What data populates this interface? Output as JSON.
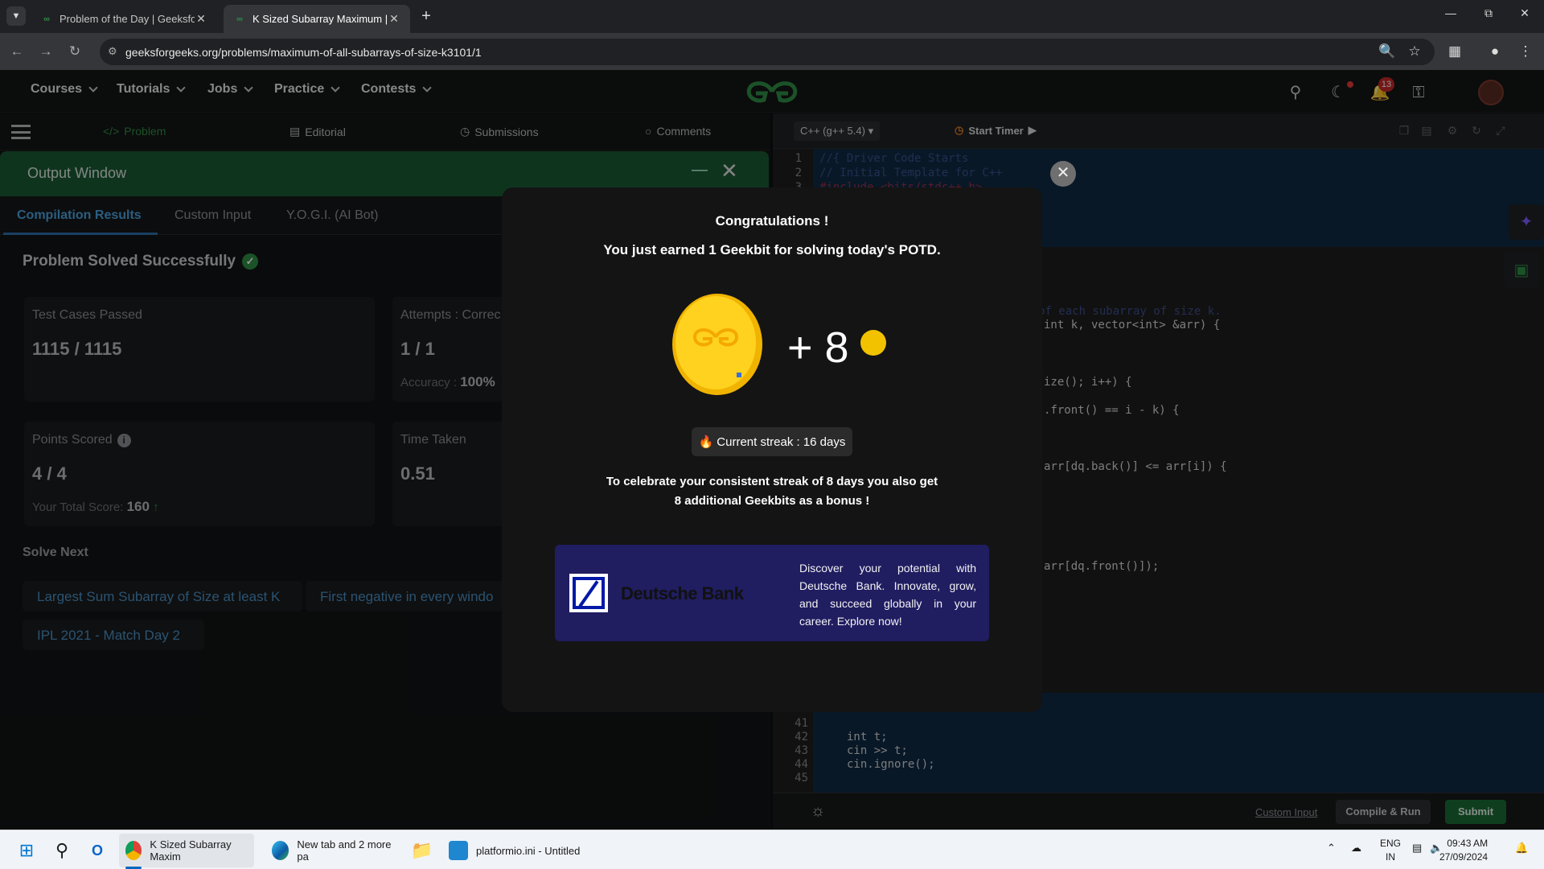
{
  "browser": {
    "tabs": [
      {
        "title": "Problem of the Day | GeeksforG",
        "favicon": "gfg-favicon"
      },
      {
        "title": "K Sized Subarray Maximum | Pr",
        "favicon": "gfg-favicon",
        "active": true
      }
    ],
    "url": "geeksforgeeks.org/problems/maximum-of-all-subarrays-of-size-k3101/1"
  },
  "site_nav": {
    "items": [
      "Courses",
      "Tutorials",
      "Jobs",
      "Practice",
      "Contests"
    ],
    "notification_count": "13",
    "brand_color": "#2f8d46"
  },
  "problem_tabs": [
    "Problem",
    "Editorial",
    "Submissions",
    "Comments"
  ],
  "output_window": {
    "title": "Output Window",
    "tabs": [
      "Compilation Results",
      "Custom Input",
      "Y.O.G.I. (AI Bot)"
    ],
    "status": "Problem Solved Successfully",
    "cards": {
      "test_cases": {
        "label": "Test Cases Passed",
        "value": "1115 / 1115"
      },
      "attempts": {
        "label": "Attempts : Correc",
        "value": "1 / 1",
        "accuracy_label": "Accuracy :",
        "accuracy_value": "100%"
      },
      "points": {
        "label": "Points Scored",
        "value": "4 / 4",
        "total_label": "Your Total Score:",
        "total_value": "160"
      },
      "time": {
        "label": "Time Taken",
        "value": "0.51"
      }
    },
    "solve_next_heading": "Solve Next",
    "solve_next": [
      "Largest Sum Subarray of Size at least K",
      "First negative in every windo",
      "IPL 2021 - Match Day 2"
    ]
  },
  "editor": {
    "language": "C++ (g++ 5.4)",
    "timer_label": "Start Timer",
    "lines_top": [
      {
        "n": "1",
        "text": "//{ Driver Code Starts"
      },
      {
        "n": "2",
        "text": "// Initial Template for C++"
      },
      {
        "n": "3",
        "text": "#include <bits/stdc++.h>"
      }
    ],
    "fragments": [
      "of each subarray of size k.",
      "int k, vector<int> &arr) {",
      "ize(); i++) {",
      ".front() == i - k) {",
      "arr[dq.back()] <= arr[i]) {",
      "arr[dq.front()]);"
    ],
    "lines_bottom": [
      {
        "n": "41",
        "text": ""
      },
      {
        "n": "42",
        "text": "int t;"
      },
      {
        "n": "43",
        "text": "cin >> t;"
      },
      {
        "n": "44",
        "text": "cin.ignore();"
      },
      {
        "n": "45",
        "text": ""
      }
    ],
    "custom_input": "Custom Input",
    "compile_run": "Compile & Run",
    "submit": "Submit"
  },
  "modal": {
    "heading": "Congratulations !",
    "earned": "You just earned 1 Geekbit for solving today's POTD.",
    "plus": "+ 8",
    "streak": "Current streak : 16 days",
    "bonus_line1": "To celebrate your consistent streak of 8 days you also get",
    "bonus_line2": "8 additional Geekbits as a bonus !",
    "ad": {
      "brand": "Deutsche Bank",
      "text": "Discover your potential with Deutsche Bank. Innovate, grow, and succeed globally in your career. Explore now!"
    }
  },
  "taskbar": {
    "apps": [
      {
        "label": "K Sized Subarray Maxim",
        "icon": "chrome-icon"
      },
      {
        "label": "New tab and 2 more pa",
        "icon": "edge-icon"
      },
      {
        "label": "platformio.ini - Untitled",
        "icon": "vscode-icon"
      }
    ],
    "lang": [
      "ENG",
      "IN"
    ],
    "time": "09:43 AM",
    "date": "27/09/2024"
  }
}
